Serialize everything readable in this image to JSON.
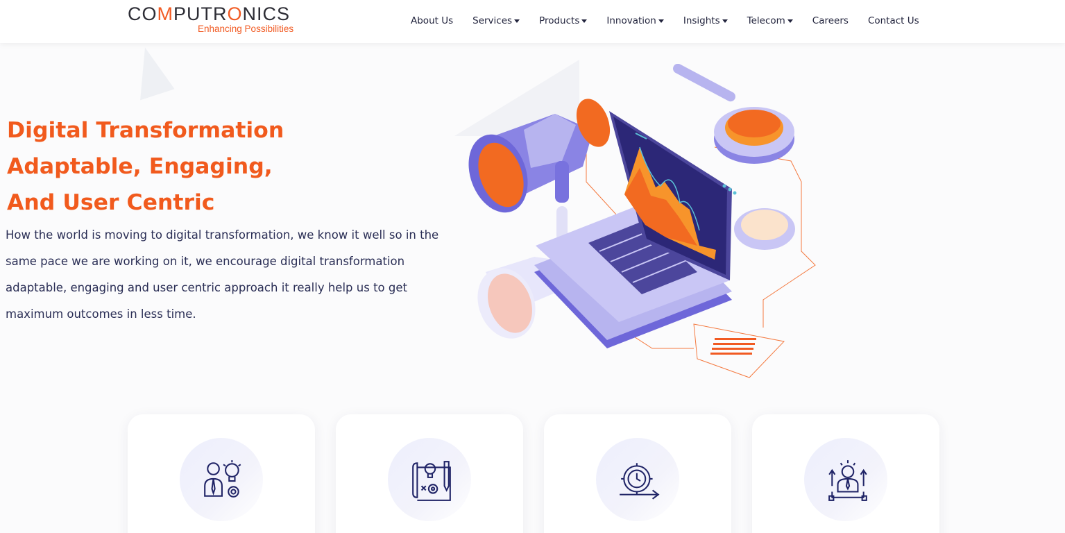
{
  "brand": {
    "logo_left": "CO",
    "logo_m": "M",
    "logo_mid": "PUTR",
    "logo_o": "O",
    "logo_right": "NICS",
    "tagline": "Enhancing Possibilities",
    "accent_color": "#f15a22"
  },
  "nav": {
    "items": [
      {
        "label": "About Us",
        "has_dropdown": false
      },
      {
        "label": "Services",
        "has_dropdown": true
      },
      {
        "label": "Products",
        "has_dropdown": true
      },
      {
        "label": "Innovation",
        "has_dropdown": true
      },
      {
        "label": "Insights",
        "has_dropdown": true
      },
      {
        "label": "Telecom",
        "has_dropdown": true
      },
      {
        "label": "Careers",
        "has_dropdown": false
      },
      {
        "label": "Contact Us",
        "has_dropdown": false
      }
    ]
  },
  "hero": {
    "title_lines": [
      "Digital Transformation",
      "Adaptable, Engaging,",
      "And User Centric"
    ],
    "description": "How the world is moving to digital transformation, we know it well so in the same pace we are working on it, we encourage digital transformation adaptable, engaging and user centric approach it really help us to get maximum outcomes in less time."
  },
  "cards": [
    {
      "icon": "consultant-idea-icon"
    },
    {
      "icon": "blueprint-design-icon"
    },
    {
      "icon": "gear-clock-process-icon"
    },
    {
      "icon": "leader-growth-icon"
    }
  ]
}
